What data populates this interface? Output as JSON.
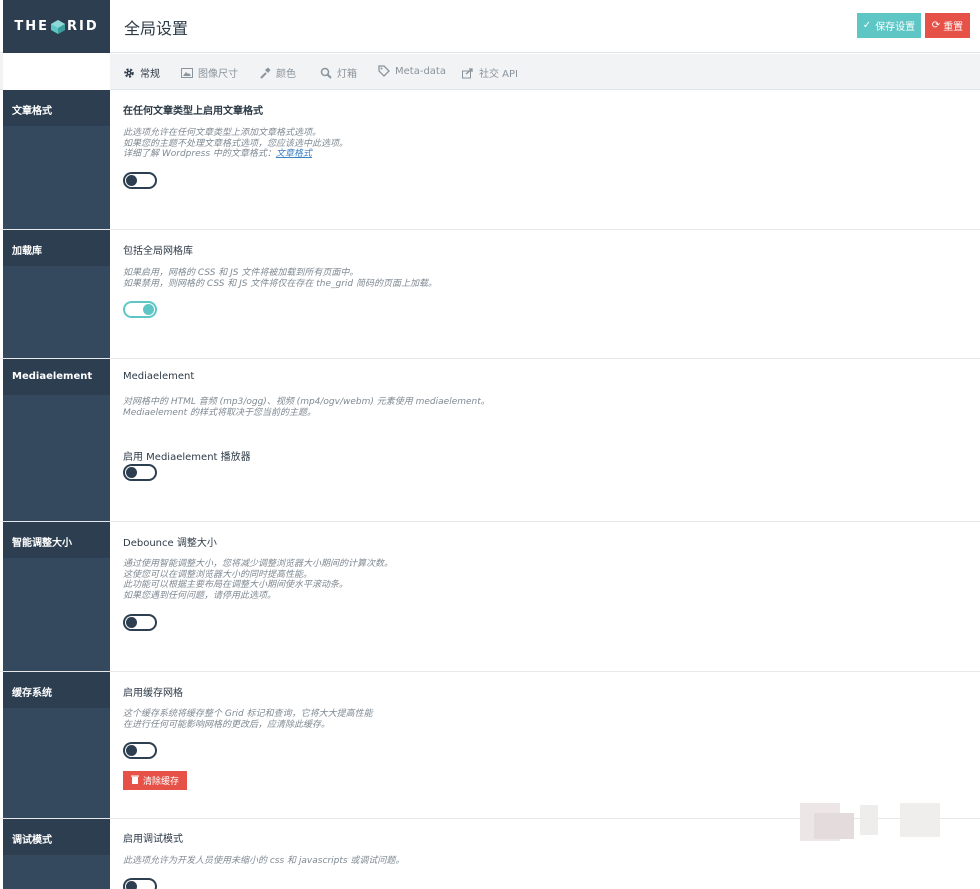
{
  "logo": {
    "left": "THE",
    "right": "RID"
  },
  "header": {
    "title": "全局设置",
    "save_label": "保存设置",
    "reset_label": "重置"
  },
  "tabs": [
    {
      "label": "常规",
      "icon": "gear-icon",
      "active": true
    },
    {
      "label": "图像尺寸",
      "icon": "image-icon",
      "active": false
    },
    {
      "label": "颜色",
      "icon": "brush-icon",
      "active": false
    },
    {
      "label": "灯箱",
      "icon": "magnifier-icon",
      "active": false
    },
    {
      "label": "Meta-data",
      "icon": "tag-icon",
      "active": false
    },
    {
      "label": "社交 API",
      "icon": "share-icon",
      "active": false
    }
  ],
  "sections": {
    "post_format": {
      "label": "文章格式",
      "heading": "在任何文章类型上启用文章格式",
      "desc": [
        "此选项允许在任何文章类型上添加文章格式选项。",
        "如果您的主题不处理文章格式选项，您应该选中此选项。"
      ],
      "desc_link_prefix": "详细了解 Wordpress 中的文章格式：",
      "desc_link": "文章格式",
      "toggle_on": false
    },
    "library": {
      "label": "加载库",
      "heading": "包括全局网格库",
      "desc": [
        "如果启用，网格的 CSS 和 JS 文件将被加载到所有页面中。",
        "如果禁用，则网格的 CSS 和 JS 文件将仅在存在 the_grid 简码的页面上加载。"
      ],
      "toggle_on": true
    },
    "mediaelement": {
      "label": "Mediaelement",
      "heading": "Mediaelement",
      "desc": [
        "对网格中的 HTML 音频 (mp3/ogg)、视频 (mp4/ogv/webm) 元素使用 mediaelement。",
        "Mediaelement 的样式将取决于您当前的主题。"
      ],
      "sub_heading": "启用 Mediaelement 播放器",
      "toggle_on": false
    },
    "smart_resize": {
      "label": "智能调整大小",
      "heading": "Debounce 调整大小",
      "desc": [
        "通过使用智能调整大小，您将减少调整浏览器大小期间的计算次数。",
        "这使您可以在调整浏览器大小的同时提高性能。",
        "此功能可以根据主要布局在调整大小期间使水平滚动条。",
        "如果您遇到任何问题，请停用此选项。"
      ],
      "toggle_on": false
    },
    "cache": {
      "label": "缓存系统",
      "heading": "启用缓存网格",
      "desc": [
        "这个缓存系统将缓存整个 Grid 标记和查询，它将大大提高性能",
        "在进行任何可能影响网格的更改后，应清除此缓存。"
      ],
      "toggle_on": false,
      "clear_label": "清除缓存"
    },
    "debug": {
      "label": "调试模式",
      "heading": "启用调试模式",
      "desc": [
        "此选项允许为开发人员使用未缩小的 css 和 javascripts 或调试问题。"
      ],
      "toggle_on": false
    }
  },
  "colors": {
    "sidebar": "#34495e",
    "label_bg": "#2c3e50",
    "accent_teal": "#5ec7c5",
    "accent_red": "#e65248"
  }
}
